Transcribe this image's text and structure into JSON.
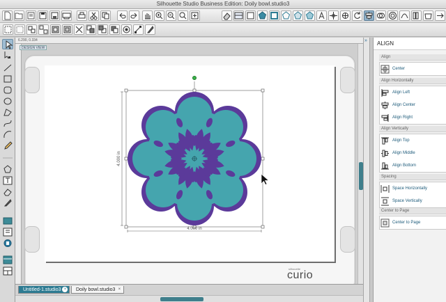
{
  "window": {
    "title": "Silhouette Studio Business Edition: Doily bowl.studio3"
  },
  "toolbar_icons": [
    "new-icon",
    "open-icon",
    "save-icon",
    "save-as-icon",
    "print-icon",
    "cut-icon",
    "copy-icon",
    "paste-icon",
    "undo-icon",
    "redo-icon",
    "pan-icon",
    "zoom-in-icon",
    "zoom-out-icon",
    "zoom-area-icon",
    "fit-to-page-icon"
  ],
  "ruler": {
    "coords": "6.290, 0.334"
  },
  "design_view_label": "DESIGN VIEW",
  "design": {
    "width_label": "4.000 in",
    "height_label": "4.000 in",
    "outer_color": "#5b3a9a",
    "inner_color": "#45a5ae",
    "accent": "#2a7f8c"
  },
  "mat_logo": {
    "small": "silhouette",
    "brand": "curio"
  },
  "tabs": [
    {
      "label": "Untitled-1.studio3",
      "active": false
    },
    {
      "label": "Doily bowl.studio3",
      "active": true
    }
  ],
  "panel": {
    "title": "ALIGN",
    "sections": [
      {
        "header": "Align",
        "buttons": [
          "Center"
        ]
      },
      {
        "header": "Align Horizontally",
        "buttons": [
          "Align Left",
          "Align Center",
          "Align Right"
        ]
      },
      {
        "header": "Align Vertically",
        "buttons": [
          "Align Top",
          "Align Middle",
          "Align Bottom"
        ]
      },
      {
        "header": "Spacing",
        "buttons": [
          "Space Horizontally",
          "Space Vertically"
        ]
      },
      {
        "header": "Center to Page",
        "buttons": [
          "Center to Page"
        ]
      }
    ]
  }
}
